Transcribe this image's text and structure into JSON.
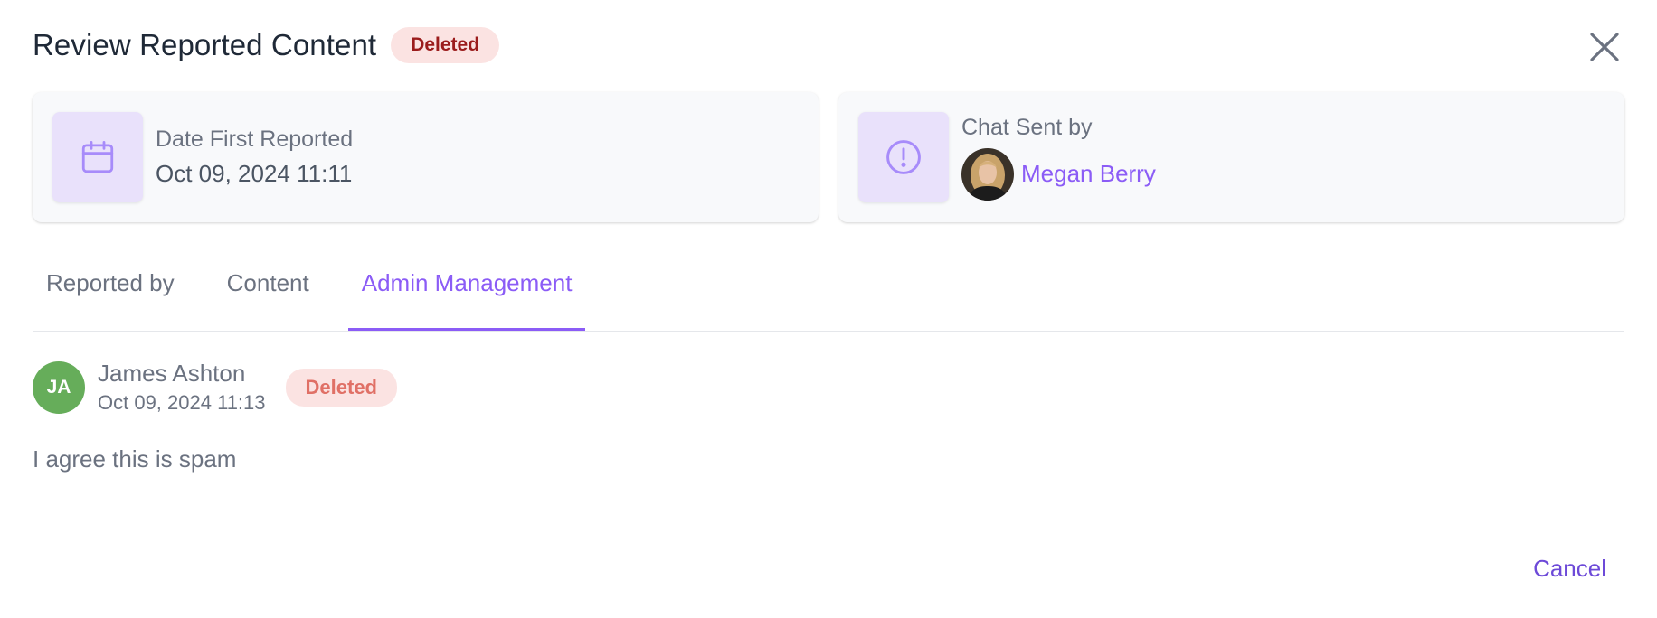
{
  "dialog": {
    "title": "Review Reported Content",
    "status_badge": "Deleted",
    "close_icon": "close-icon"
  },
  "cards": {
    "date_reported": {
      "icon": "calendar-icon",
      "label": "Date First Reported",
      "value": "Oct 09, 2024 11:11"
    },
    "chat_sender": {
      "icon": "alert-circle-icon",
      "label": "Chat Sent by",
      "name": "Megan Berry",
      "avatar": "user-avatar"
    }
  },
  "tabs": [
    {
      "label": "Reported by",
      "active": false
    },
    {
      "label": "Content",
      "active": false
    },
    {
      "label": "Admin Management",
      "active": true
    }
  ],
  "comment": {
    "initials": "JA",
    "author": "James Ashton",
    "timestamp": "Oct 09, 2024 11:13",
    "status": "Deleted",
    "body": "I agree this is spam"
  },
  "footer": {
    "cancel_label": "Cancel"
  },
  "colors": {
    "accent": "#8b5cf6",
    "badge_bg": "#fbe3e2",
    "badge_text_dark": "#9b1c1c",
    "badge_text_light": "#e07066",
    "icon_box_bg": "#e9e1fb",
    "avatar_green": "#66ad5a"
  }
}
